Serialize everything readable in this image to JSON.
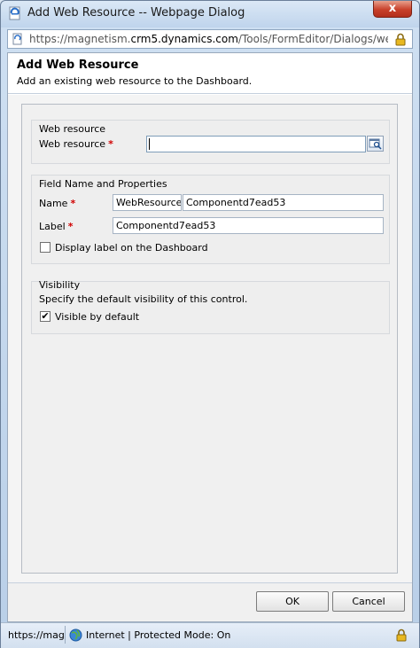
{
  "window": {
    "title": "Add Web Resource -- Webpage Dialog",
    "close_label": "x"
  },
  "address": {
    "prefix": "https://magnetism.",
    "domain": "crm5.dynamics.com",
    "path": "/Tools/FormEditor/Dialogs/webresour"
  },
  "dialog": {
    "title": "Add Web Resource",
    "subtitle": "Add an existing web resource to the Dashboard."
  },
  "web_resource": {
    "section_title": "Web resource",
    "label": "Web resource",
    "required_mark": "*",
    "value": ""
  },
  "field_props": {
    "section_title": "Field Name and Properties",
    "name_label": "Name",
    "name_prefix": "WebResource_",
    "name_value": "Componentd7ead53",
    "label_label": "Label",
    "label_value": "Componentd7ead53",
    "required_mark": "*",
    "display_label_text": "Display label on the Dashboard",
    "display_label_checked": false
  },
  "visibility": {
    "section_title": "Visibility",
    "description": "Specify the default visibility of this control.",
    "visible_text": "Visible by default",
    "visible_checked": true,
    "check_glyph": "✔"
  },
  "footer": {
    "ok_label": "OK",
    "cancel_label": "Cancel"
  },
  "status": {
    "url": "https://mag",
    "zone": "Internet | Protected Mode: On"
  }
}
